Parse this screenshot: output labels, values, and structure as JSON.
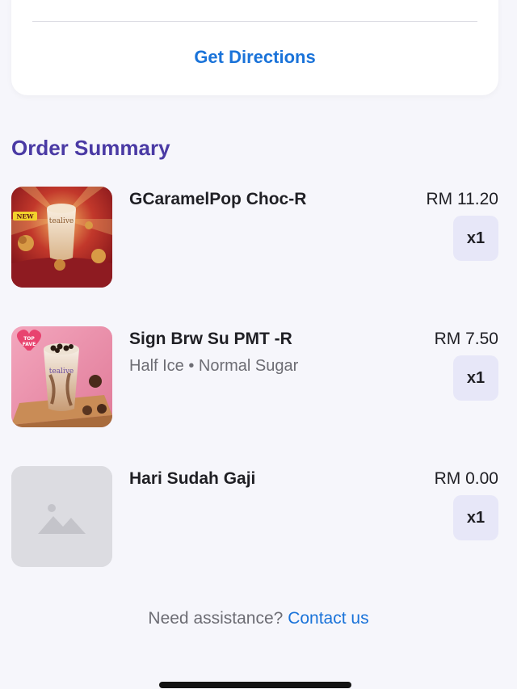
{
  "location": {
    "directions_label": "Get Directions"
  },
  "order_summary": {
    "title": "Order Summary",
    "items": [
      {
        "name": "GCaramelPop Choc-R",
        "options": "",
        "price": "RM 11.20",
        "quantity": "x1",
        "image": "caramel-pop-drink-image",
        "badge": "NEW",
        "brand": "tealive"
      },
      {
        "name": "Sign Brw Su PMT -R",
        "options": "Half Ice • Normal Sugar",
        "price": "RM 7.50",
        "quantity": "x1",
        "image": "pearl-milk-tea-image",
        "badge": "TOP FAVE",
        "brand": "tealive"
      },
      {
        "name": "Hari Sudah Gaji",
        "options": "",
        "price": "RM 0.00",
        "quantity": "x1",
        "image": "placeholder-image-icon"
      }
    ]
  },
  "support": {
    "prompt": "Need assistance?",
    "link_label": "Contact us"
  },
  "colors": {
    "accent_blue": "#1a73d9",
    "heading_purple": "#4a3aa4",
    "quantity_bg": "#e7e7f8",
    "page_bg": "#f6f6fb"
  }
}
